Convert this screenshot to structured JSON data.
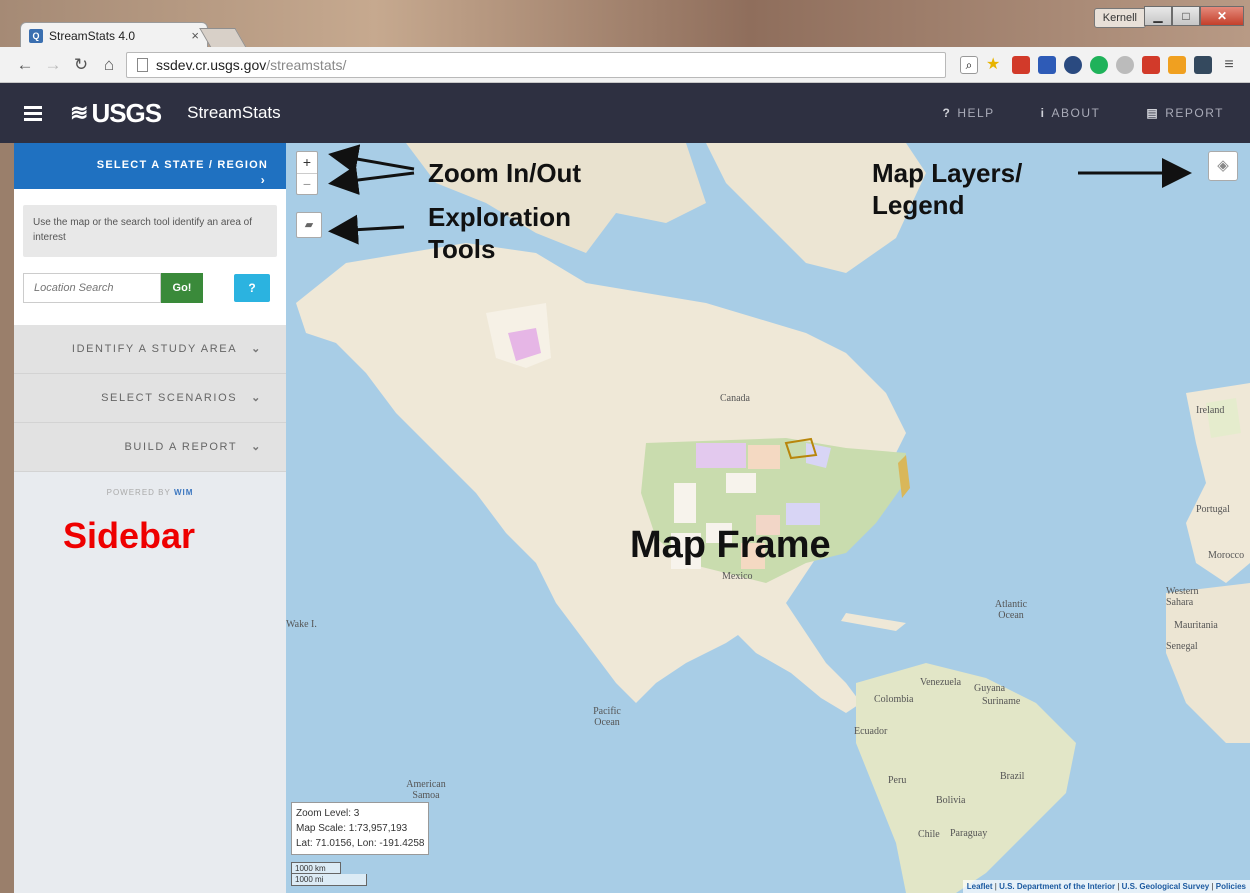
{
  "browser": {
    "tab_title": "StreamStats 4.0",
    "tab_close": "×",
    "window_user": "Kernell",
    "url_host": "ssdev.cr.usgs.gov",
    "url_path": "/streamstats/"
  },
  "app": {
    "logo": "USGS",
    "title": "StreamStats",
    "nav": [
      {
        "icon": "?",
        "label": "HELP"
      },
      {
        "icon": "i",
        "label": "ABOUT"
      },
      {
        "icon": "▤",
        "label": "REPORT"
      }
    ]
  },
  "sidebar": {
    "header": "SELECT A STATE / REGION",
    "info_text": "Use the map or the search tool identify an area of interest",
    "search_placeholder": "Location Search",
    "go_label": "Go!",
    "help_label": "?",
    "sections": [
      "IDENTIFY A STUDY AREA",
      "SELECT SCENARIOS",
      "BUILD A REPORT"
    ],
    "powered_prefix": "POWERED BY",
    "powered_brand": "WIM"
  },
  "map": {
    "zoom_in": "+",
    "zoom_out": "−",
    "labels": {
      "canada": "Canada",
      "mexico": "Mexico",
      "atlantic": "Atlantic Ocean",
      "pacific": "Pacific Ocean",
      "venezuela": "Venezuela",
      "colombia": "Colombia",
      "guyana": "Guyana",
      "suriname": "Suriname",
      "ecuador": "Ecuador",
      "peru": "Peru",
      "brazil": "Brazil",
      "bolivia": "Bolivia",
      "chile": "Chile",
      "paraguay": "Paraguay",
      "ireland": "Ireland",
      "portugal": "Portugal",
      "morocco": "Morocco",
      "western_sahara": "Western Sahara",
      "mauritania": "Mauritania",
      "senegal": "Senegal",
      "american_samoa": "American Samoa",
      "wake": "Wake I."
    },
    "status": {
      "zoom": "Zoom Level: 3",
      "scale": "Map Scale: 1:73,957,193",
      "coords": "Lat: 71.0156, Lon: -191.4258"
    },
    "scale_km": "1000 km",
    "scale_mi": "1000 mi",
    "attribution": [
      "Leaflet",
      "U.S. Department of the Interior",
      "U.S. Geological Survey",
      "Policies"
    ]
  },
  "annotations": {
    "zoom": "Zoom In/Out",
    "exploration": "Exploration Tools",
    "layers": "Map Layers/ Legend",
    "sidebar": "Sidebar",
    "map_frame": "Map Frame"
  }
}
